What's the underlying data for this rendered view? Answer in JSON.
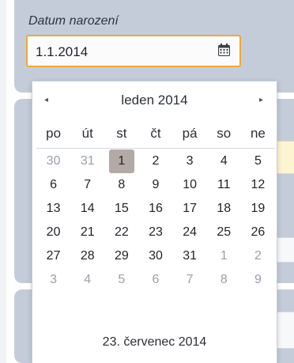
{
  "field": {
    "label": "Datum narození",
    "value": "1.1.2014",
    "icon": "calendar-icon"
  },
  "datepicker": {
    "prev_arrow": "◂",
    "next_arrow": "▸",
    "month_title": "leden 2014",
    "weekdays": [
      "po",
      "út",
      "st",
      "čt",
      "pá",
      "so",
      "ne"
    ],
    "weeks": [
      [
        {
          "d": "30",
          "muted": true
        },
        {
          "d": "31",
          "muted": true
        },
        {
          "d": "1",
          "selected": true
        },
        {
          "d": "2"
        },
        {
          "d": "3"
        },
        {
          "d": "4"
        },
        {
          "d": "5"
        }
      ],
      [
        {
          "d": "6"
        },
        {
          "d": "7"
        },
        {
          "d": "8"
        },
        {
          "d": "9"
        },
        {
          "d": "10"
        },
        {
          "d": "11"
        },
        {
          "d": "12"
        }
      ],
      [
        {
          "d": "13"
        },
        {
          "d": "14"
        },
        {
          "d": "15"
        },
        {
          "d": "16"
        },
        {
          "d": "17"
        },
        {
          "d": "18"
        },
        {
          "d": "19"
        }
      ],
      [
        {
          "d": "20"
        },
        {
          "d": "21"
        },
        {
          "d": "22"
        },
        {
          "d": "23"
        },
        {
          "d": "24"
        },
        {
          "d": "25"
        },
        {
          "d": "26"
        }
      ],
      [
        {
          "d": "27"
        },
        {
          "d": "28"
        },
        {
          "d": "29"
        },
        {
          "d": "30"
        },
        {
          "d": "31"
        },
        {
          "d": "1",
          "muted": true
        },
        {
          "d": "2",
          "muted": true
        }
      ],
      [
        {
          "d": "3",
          "muted": true
        },
        {
          "d": "4",
          "muted": true
        },
        {
          "d": "5",
          "muted": true
        },
        {
          "d": "6",
          "muted": true
        },
        {
          "d": "7",
          "muted": true
        },
        {
          "d": "8",
          "muted": true
        },
        {
          "d": "9",
          "muted": true
        }
      ]
    ],
    "today_label": "23. červenec 2014"
  },
  "colors": {
    "input_focus_border": "#f0a83a",
    "selected_day_bg": "#b3aaa6",
    "panel_bg": "#c4ccda"
  }
}
